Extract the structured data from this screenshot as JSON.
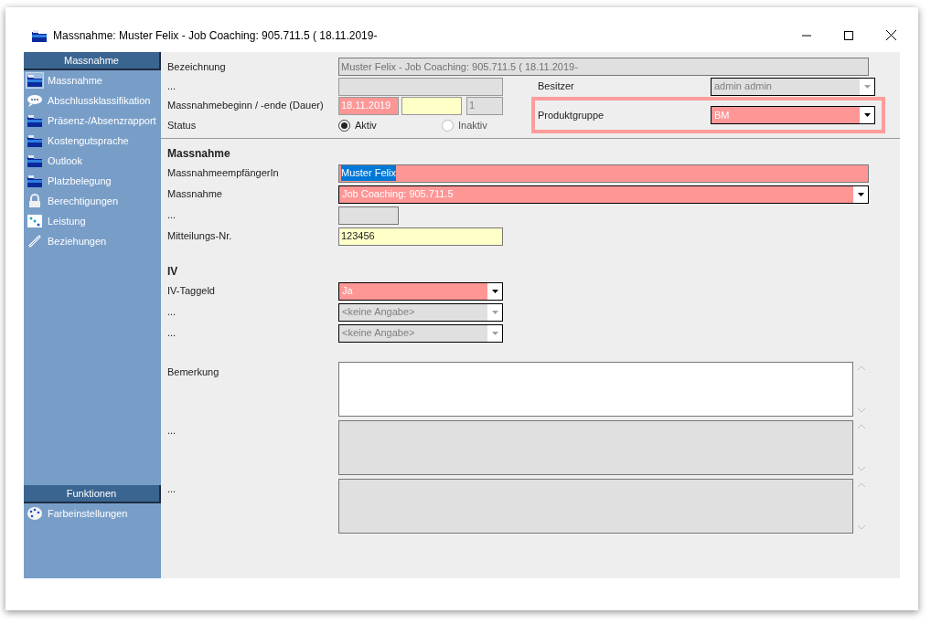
{
  "window": {
    "title": "Massnahme: Muster Felix - Job Coaching: 905.711.5 ( 18.11.2019-"
  },
  "sidebar": {
    "sections": [
      {
        "title": "Massnahme",
        "items": [
          {
            "label": "Massnahme",
            "kind": "folder",
            "selected": true
          },
          {
            "label": "Abschlussklassifikation",
            "kind": "chat",
            "selected": false
          },
          {
            "label": "Präsenz-/Absenzrapport",
            "kind": "folder",
            "selected": false
          },
          {
            "label": "Kostengutsprache",
            "kind": "folder",
            "selected": false
          },
          {
            "label": "Outlook",
            "kind": "folder",
            "selected": false
          },
          {
            "label": "Platzbelegung",
            "kind": "folder",
            "selected": false
          },
          {
            "label": "Berechtigungen",
            "kind": "lock",
            "selected": false
          },
          {
            "label": "Leistung",
            "kind": "dots",
            "selected": false
          },
          {
            "label": "Beziehungen",
            "kind": "link",
            "selected": false
          }
        ]
      },
      {
        "title": "Funktionen",
        "items": [
          {
            "label": "Farbeinstellungen",
            "kind": "palette",
            "selected": false
          }
        ]
      }
    ]
  },
  "top": {
    "bezeichnung": {
      "label": "Bezeichnung",
      "value": "Muster Felix - Job Coaching: 905.711.5 ( 18.11.2019-"
    },
    "extra": {
      "label": "..."
    },
    "dates": {
      "label": "Massnahmebeginn / -ende (Dauer)",
      "start": "18.11.2019",
      "duration": "1"
    },
    "status": {
      "label": "Status",
      "options": [
        {
          "label": "Aktiv",
          "selected": true
        },
        {
          "label": "Inaktiv",
          "selected": false
        }
      ]
    },
    "besitzer": {
      "label": "Besitzer",
      "value": "admin admin"
    },
    "produktgruppe": {
      "label": "Produktgruppe",
      "value": "BM",
      "highlighted": true
    }
  },
  "sections": [
    {
      "title": "Massnahme",
      "rows": [
        {
          "label": "MassnahmeempfängerIn",
          "kind": "wide-text",
          "color": "#ff9696",
          "disabled": false,
          "value": "Muster Felix",
          "text_selected": true
        },
        {
          "label": "Massnahme",
          "kind": "wide-select",
          "color": "#ff9696",
          "disabled": false,
          "value": "Job Coaching: 905.711.5"
        },
        {
          "label": "...",
          "kind": "stub",
          "color": "#e0e0e0"
        },
        {
          "label": "Mitteilungs-Nr.",
          "kind": "text",
          "color": "#ffffc8",
          "disabled": false,
          "value": "123456"
        }
      ]
    },
    {
      "title": "IV",
      "rows": [
        {
          "label": "IV-Taggeld",
          "kind": "select",
          "color": "#ff9696",
          "disabled": false,
          "value": "Ja"
        },
        {
          "label": "...",
          "kind": "select",
          "color": "#e0e0e0",
          "disabled": true,
          "value": "<keine Angabe>"
        },
        {
          "label": "...",
          "kind": "select",
          "color": "#e0e0e0",
          "disabled": true,
          "value": "<keine Angabe>"
        }
      ]
    }
  ],
  "memos": [
    {
      "label": "Bemerkung",
      "color": "#ffffff"
    },
    {
      "label": "...",
      "color": "#e0e0e0"
    },
    {
      "label": "...",
      "color": "#e0e0e0"
    }
  ]
}
